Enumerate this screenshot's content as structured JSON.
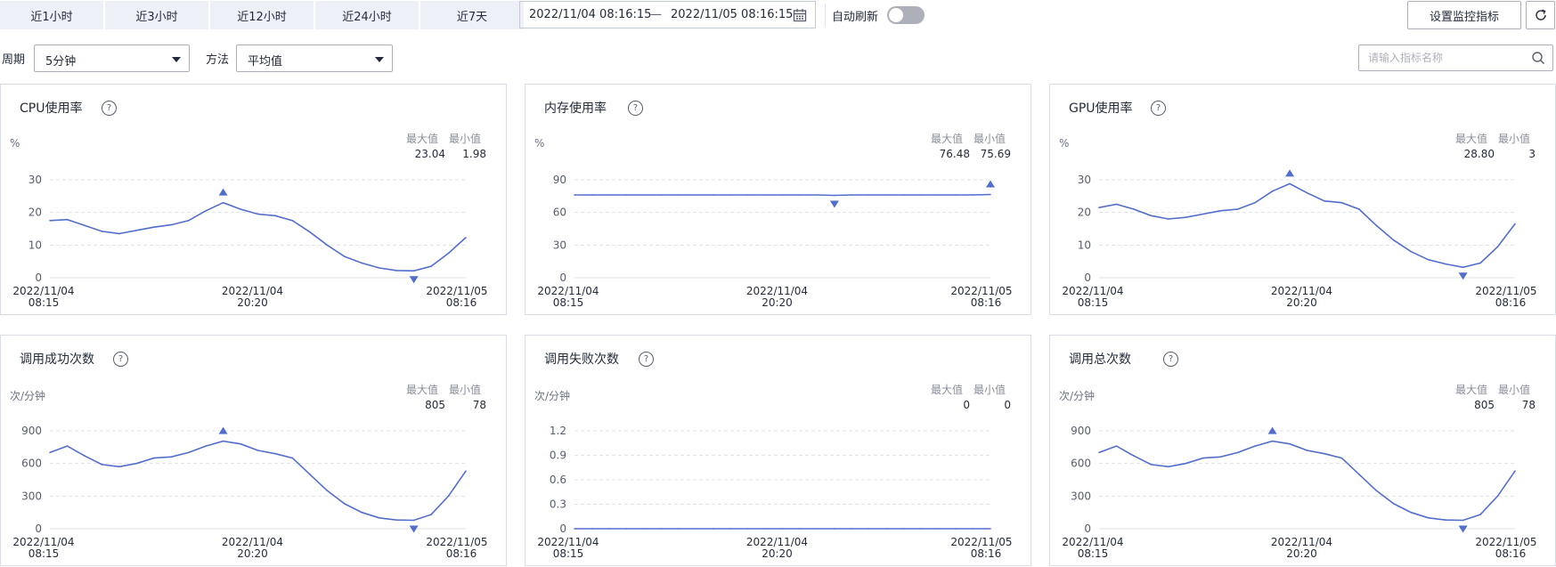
{
  "time_tabs": [
    "近1小时",
    "近3小时",
    "近12小时",
    "近24小时",
    "近7天"
  ],
  "date_range": {
    "start": "2022/11/04 08:16:15",
    "sep": "—",
    "end": "2022/11/05 08:16:15"
  },
  "auto_refresh": {
    "label": "自动刷新",
    "on": false
  },
  "set_metrics_button": "设置监控指标",
  "period": {
    "label": "周期",
    "value": "5分钟"
  },
  "method": {
    "label": "方法",
    "value": "平均值"
  },
  "search": {
    "placeholder": "请输入指标名称"
  },
  "stat_headers": {
    "max": "最大值",
    "min": "最小值"
  },
  "x_ticks": [
    {
      "date": "2022/11/04",
      "time": "08:15"
    },
    {
      "date": "2022/11/04",
      "time": "20:20"
    },
    {
      "date": "2022/11/05",
      "time": "08:16"
    }
  ],
  "colors": {
    "line": "#526ecc",
    "grid": "#dfe1e6",
    "tab_bg": "#edf0f7"
  },
  "cards": [
    {
      "title": "CPU使用率",
      "unit": "%",
      "max": "23.04",
      "min": "1.98"
    },
    {
      "title": "内存使用率",
      "unit": "%",
      "max": "76.48",
      "min": "75.69"
    },
    {
      "title": "GPU使用率",
      "unit": "%",
      "max": "28.80",
      "min": "3"
    },
    {
      "title": "调用成功次数",
      "unit": "次/分钟",
      "max": "805",
      "min": "78"
    },
    {
      "title": "调用失败次数",
      "unit": "次/分钟",
      "max": "0",
      "min": "0"
    },
    {
      "title": "调用总次数",
      "unit": "次/分钟",
      "max": "805",
      "min": "78"
    }
  ],
  "chart_data": [
    {
      "type": "line",
      "title": "CPU使用率",
      "ylabel": "%",
      "ylim": [
        0,
        30
      ],
      "yticks": [
        "30",
        "20",
        "10",
        "0"
      ],
      "x": [
        "2022/11/04 08:15",
        "2022/11/04 20:20",
        "2022/11/05 08:16"
      ],
      "values": [
        17.5,
        17.8,
        16.0,
        14.2,
        13.5,
        14.5,
        15.5,
        16.2,
        17.5,
        20.5,
        23.0,
        21.0,
        19.5,
        19.0,
        17.5,
        14.0,
        10.0,
        6.5,
        4.5,
        3.0,
        2.2,
        2.1,
        3.5,
        7.5,
        12.3
      ],
      "max_marker_index": 10,
      "min_marker_index": 21
    },
    {
      "type": "line",
      "title": "内存使用率",
      "ylabel": "%",
      "ylim": [
        0,
        90
      ],
      "yticks": [
        "90",
        "60",
        "30",
        "0"
      ],
      "x": [
        "2022/11/04 08:15",
        "2022/11/04 20:20",
        "2022/11/05 08:16"
      ],
      "values": [
        76.1,
        76.1,
        76.1,
        76.1,
        76.1,
        76.1,
        76.1,
        76.1,
        76.1,
        76.1,
        76.1,
        76.1,
        76.1,
        76.1,
        76.1,
        75.7,
        76.1,
        76.1,
        76.1,
        76.1,
        76.1,
        76.1,
        76.1,
        76.1,
        76.5
      ],
      "max_marker_index": 24,
      "min_marker_index": 15
    },
    {
      "type": "line",
      "title": "GPU使用率",
      "ylabel": "%",
      "ylim": [
        0,
        30
      ],
      "yticks": [
        "30",
        "20",
        "10",
        "0"
      ],
      "x": [
        "2022/11/04 08:15",
        "2022/11/04 20:20",
        "2022/11/05 08:16"
      ],
      "values": [
        21.5,
        22.5,
        21.0,
        19.0,
        18.0,
        18.5,
        19.5,
        20.5,
        21.0,
        23.0,
        26.5,
        28.8,
        26.0,
        23.5,
        23.0,
        21.0,
        16.0,
        11.5,
        8.0,
        5.5,
        4.2,
        3.2,
        4.5,
        9.5,
        16.5
      ],
      "max_marker_index": 11,
      "min_marker_index": 21
    },
    {
      "type": "line",
      "title": "调用成功次数",
      "ylabel": "次/分钟",
      "ylim": [
        0,
        900
      ],
      "yticks": [
        "900",
        "600",
        "300",
        "0"
      ],
      "x": [
        "2022/11/04 08:15",
        "2022/11/04 20:20",
        "2022/11/05 08:16"
      ],
      "values": [
        700,
        760,
        670,
        590,
        570,
        600,
        650,
        660,
        700,
        760,
        805,
        780,
        720,
        690,
        650,
        500,
        350,
        230,
        150,
        100,
        80,
        78,
        130,
        300,
        530
      ],
      "max_marker_index": 10,
      "min_marker_index": 21
    },
    {
      "type": "line",
      "title": "调用失败次数",
      "ylabel": "次/分钟",
      "ylim": [
        0,
        1.2
      ],
      "yticks": [
        "1.2",
        "0.9",
        "0.6",
        "0.3",
        "0"
      ],
      "x": [
        "2022/11/04 08:15",
        "2022/11/04 20:20",
        "2022/11/05 08:16"
      ],
      "values": [
        0,
        0,
        0,
        0,
        0,
        0,
        0,
        0,
        0,
        0,
        0,
        0,
        0,
        0,
        0,
        0,
        0,
        0,
        0,
        0,
        0,
        0,
        0,
        0,
        0
      ],
      "max_marker_index": null,
      "min_marker_index": null
    },
    {
      "type": "line",
      "title": "调用总次数",
      "ylabel": "次/分钟",
      "ylim": [
        0,
        900
      ],
      "yticks": [
        "900",
        "600",
        "300",
        "0"
      ],
      "x": [
        "2022/11/04 08:15",
        "2022/11/04 20:20",
        "2022/11/05 08:16"
      ],
      "values": [
        700,
        760,
        670,
        590,
        570,
        600,
        650,
        660,
        700,
        760,
        805,
        780,
        720,
        690,
        650,
        500,
        350,
        230,
        150,
        100,
        80,
        78,
        130,
        300,
        530
      ],
      "max_marker_index": 10,
      "min_marker_index": 21
    }
  ]
}
